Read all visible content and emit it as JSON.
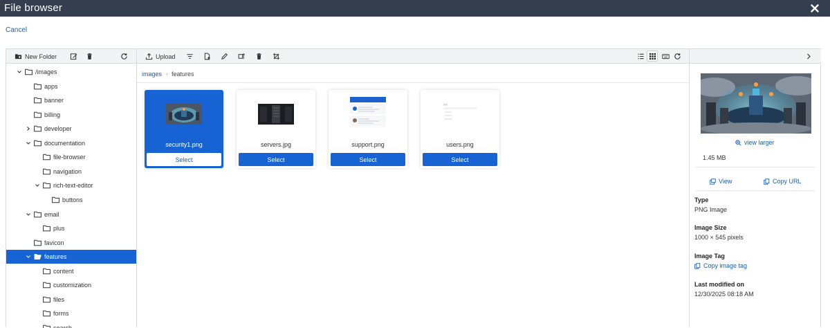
{
  "window": {
    "title": "File browser",
    "close_icon": "close-icon"
  },
  "cancel_label": "Cancel",
  "left_toolbar": {
    "new_folder_label": "New Folder",
    "icons": [
      "folder-plus-icon",
      "edit-icon",
      "trash-icon",
      "refresh-icon"
    ]
  },
  "main_toolbar": {
    "upload_label": "Upload",
    "icons": [
      "upload-icon",
      "filter-icon",
      "new-file-icon",
      "pencil-icon",
      "resize-icon",
      "trash-icon",
      "crop-icon",
      "list-view-icon",
      "grid-view-icon",
      "keyboard-icon",
      "refresh-icon"
    ]
  },
  "tree": [
    {
      "label": "/images",
      "expanded": true,
      "active": false
    },
    {
      "label": "apps",
      "expanded": null,
      "active": false
    },
    {
      "label": "banner",
      "expanded": null,
      "active": false
    },
    {
      "label": "billing",
      "expanded": null,
      "active": false
    },
    {
      "label": "developer",
      "expanded": false,
      "active": false
    },
    {
      "label": "documentation",
      "expanded": true,
      "active": false
    },
    {
      "label": "file-browser",
      "expanded": null,
      "active": false
    },
    {
      "label": "navigation",
      "expanded": null,
      "active": false
    },
    {
      "label": "rich-text-editor",
      "expanded": true,
      "active": false
    },
    {
      "label": "buttons",
      "expanded": null,
      "active": false
    },
    {
      "label": "email",
      "expanded": true,
      "active": false
    },
    {
      "label": "plus",
      "expanded": null,
      "active": false
    },
    {
      "label": "favicon",
      "expanded": null,
      "active": false
    },
    {
      "label": "features",
      "expanded": true,
      "active": true
    },
    {
      "label": "content",
      "expanded": null,
      "active": false
    },
    {
      "label": "customization",
      "expanded": null,
      "active": false
    },
    {
      "label": "files",
      "expanded": null,
      "active": false
    },
    {
      "label": "forms",
      "expanded": null,
      "active": false
    },
    {
      "label": "search",
      "expanded": null,
      "active": false
    }
  ],
  "breadcrumb": {
    "root": "images",
    "separator": "›",
    "current": "features"
  },
  "files": [
    {
      "name": "security1.png",
      "select_label": "Select",
      "selected": true
    },
    {
      "name": "servers.jpg",
      "select_label": "Select",
      "selected": false
    },
    {
      "name": "support.png",
      "select_label": "Select",
      "selected": false
    },
    {
      "name": "users.png",
      "select_label": "Select",
      "selected": false
    }
  ],
  "details": {
    "view_larger_label": "view larger",
    "file_size": "1.45 MB",
    "view_label": "View",
    "copy_url_label": "Copy URL",
    "type_heading": "Type",
    "type_value": "PNG Image",
    "image_size_heading": "Image Size",
    "image_size_value": "1000 × 545 pixels",
    "image_tag_heading": "Image Tag",
    "copy_tag_label": "Copy image tag",
    "modified_heading": "Last modified on",
    "modified_value": "12/30/2025 08:18 AM"
  },
  "colors": {
    "titlebar": "#343e4f",
    "accent": "#1763d3",
    "link": "#1a5fb4",
    "border": "#d6d9dd"
  }
}
